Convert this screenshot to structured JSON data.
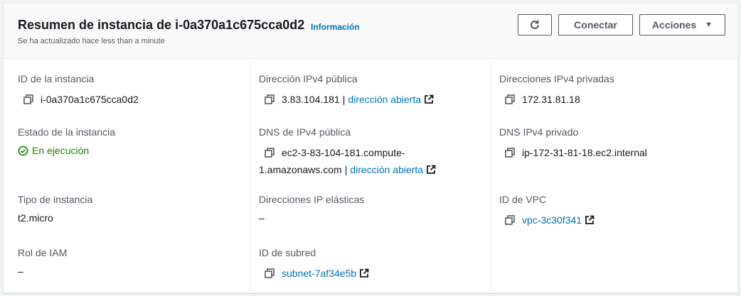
{
  "header": {
    "title": "Resumen de instancia de i-0a370a1c675cca0d2",
    "info_link": "Información",
    "subtitle": "Se ha actualizado hace less than a minute",
    "connect_label": "Conectar",
    "actions_label": "Acciones"
  },
  "fields": {
    "instance_id": {
      "label": "ID de la instancia",
      "value": "i-0a370a1c675cca0d2"
    },
    "public_ipv4": {
      "label": "Dirección IPv4 pública",
      "value": "3.83.104.181",
      "separator": "|",
      "link": "dirección abierta"
    },
    "private_ipv4": {
      "label": "Direcciones IPv4 privadas",
      "value": "172.31.81.18"
    },
    "instance_state": {
      "label": "Estado de la instancia",
      "value": "En ejecución"
    },
    "public_dns": {
      "label": "DNS de IPv4 pública",
      "value_line1": "ec2-3-83-104-181.compute-",
      "value_line2": "1.amazonaws.com",
      "separator": "|",
      "link": "dirección abierta"
    },
    "private_dns": {
      "label": "DNS IPv4 privado",
      "value": "ip-172-31-81-18.ec2.internal"
    },
    "instance_type": {
      "label": "Tipo de instancia",
      "value": "t2.micro"
    },
    "elastic_ip": {
      "label": "Direcciones IP elásticas",
      "value": "–"
    },
    "vpc_id": {
      "label": "ID de VPC",
      "value": "vpc-3c30f341"
    },
    "iam_role": {
      "label": "Rol de IAM",
      "value": "–"
    },
    "subnet_id": {
      "label": "ID de subred",
      "value": "subnet-7af34e5b"
    }
  },
  "colors": {
    "link": "#0073bb",
    "success": "#1d8102",
    "label": "#545b64"
  }
}
